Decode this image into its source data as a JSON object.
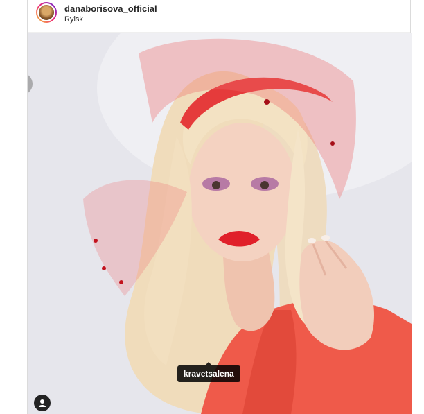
{
  "post": {
    "username": "danaborisova_official",
    "location": "Rylsk",
    "avatar_icon": "profile-avatar",
    "tagged_user": "kravetsalena",
    "tags_button_icon": "user-icon"
  },
  "colors": {
    "dress": "#ef5a4a",
    "veil": "#e53b3b",
    "hair": "#f2dfbf",
    "lips": "#e0202a",
    "skin": "#f2cdbb"
  }
}
